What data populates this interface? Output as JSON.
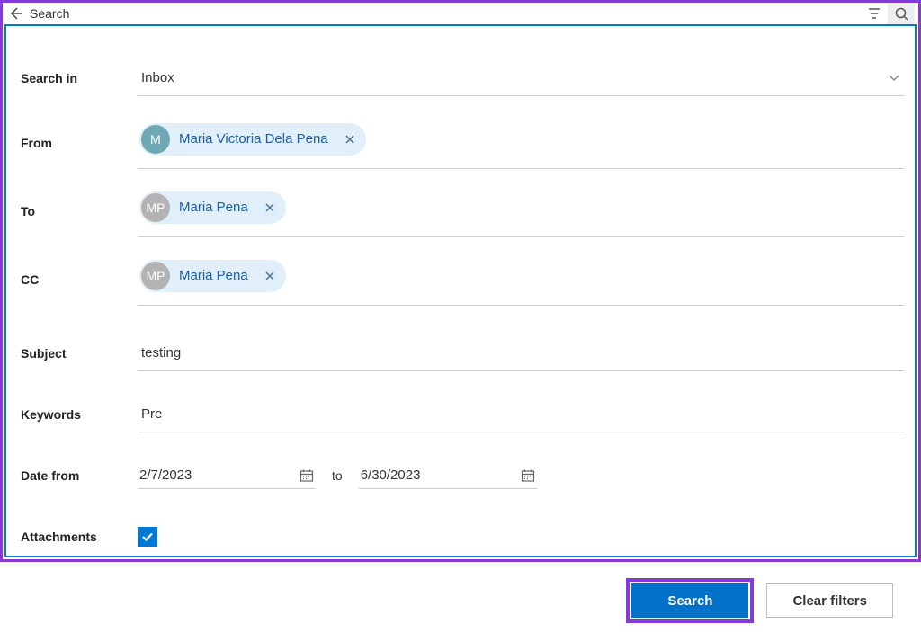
{
  "header": {
    "title": "Search"
  },
  "searchIn": {
    "label": "Search in",
    "value": "Inbox"
  },
  "from": {
    "label": "From",
    "chip": {
      "initials": "M",
      "name": "Maria Victoria Dela Pena",
      "avatarColor": "teal"
    }
  },
  "to": {
    "label": "To",
    "chip": {
      "initials": "MP",
      "name": "Maria Pena",
      "avatarColor": "grey"
    }
  },
  "cc": {
    "label": "CC",
    "chip": {
      "initials": "MP",
      "name": "Maria Pena",
      "avatarColor": "grey"
    }
  },
  "subject": {
    "label": "Subject",
    "value": "testing"
  },
  "keywords": {
    "label": "Keywords",
    "value": "Pre"
  },
  "date": {
    "label": "Date from",
    "from": "2/7/2023",
    "separator": "to",
    "to": "6/30/2023"
  },
  "attachments": {
    "label": "Attachments",
    "checked": true
  },
  "buttons": {
    "search": "Search",
    "clear": "Clear filters"
  }
}
